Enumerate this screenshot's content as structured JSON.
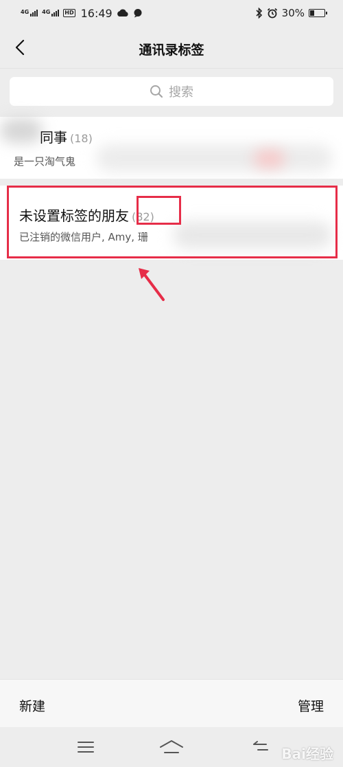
{
  "status_bar": {
    "signal_1": "4G",
    "signal_2": "4G",
    "hd": "HD",
    "time": "16:49",
    "battery": "30%",
    "battery_level": 0.3
  },
  "header": {
    "title": "通讯录标签"
  },
  "search": {
    "placeholder": "搜索"
  },
  "tags": [
    {
      "name": "同事",
      "count": "(18)",
      "members": "是一只淘气鬼"
    },
    {
      "name": "未设置标签的朋友",
      "count": "(82)",
      "members": "已注销的微信用户, Amy, 珊"
    }
  ],
  "bottom_bar": {
    "new_label": "新建",
    "manage_label": "管理"
  },
  "watermark": "Bai经验",
  "colors": {
    "annotation": "#e62d48",
    "background": "#ededed"
  }
}
